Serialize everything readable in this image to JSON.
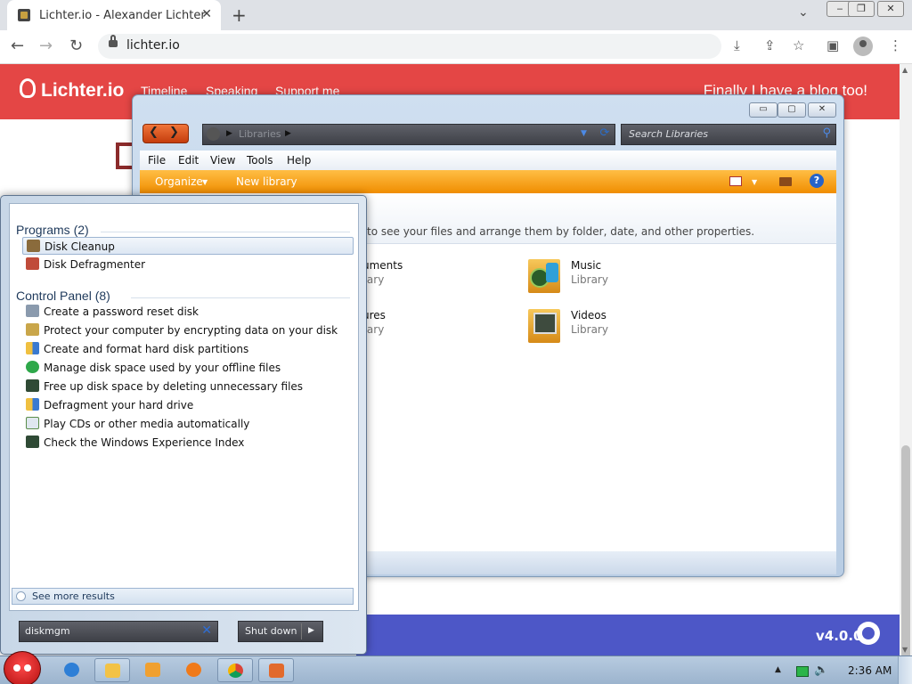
{
  "browser": {
    "tab_title": "Lichter.io - Alexander Lichter",
    "new_tab_glyph": "+",
    "url": "lichter.io"
  },
  "site": {
    "logo": "Lichter.io",
    "nav": [
      "Timeline",
      "Speaking",
      "Support me"
    ],
    "tagline": "Finally I have a blog too!",
    "version": "v4.0.0"
  },
  "explorer": {
    "breadcrumb": "Libraries",
    "search_placeholder": "Search Libraries",
    "menu": [
      "File",
      "Edit",
      "View",
      "Tools",
      "Help"
    ],
    "commands": {
      "organize": "Organize",
      "new_library": "New library"
    },
    "info_text": "to see your files and arrange them by folder, date, and other properties.",
    "libraries": [
      {
        "name": "uments",
        "type": "rary"
      },
      {
        "name": "Music",
        "type": "Library"
      },
      {
        "name": "ures",
        "type": "rary"
      },
      {
        "name": "Videos",
        "type": "Library"
      }
    ]
  },
  "start_menu": {
    "programs_heading": "Programs (2)",
    "programs": [
      "Disk Cleanup",
      "Disk Defragmenter"
    ],
    "control_panel_heading": "Control Panel (8)",
    "control_panel": [
      "Create a password reset disk",
      "Protect your computer by encrypting data on your disk",
      "Create and format hard disk partitions",
      "Manage disk space used by your offline files",
      "Free up disk space by deleting unnecessary files",
      "Defragment your hard drive",
      "Play CDs or other media automatically",
      "Check the Windows Experience Index"
    ],
    "see_more": "See more results",
    "search_value": "diskmgm",
    "shutdown": "Shut down"
  },
  "taskbar": {
    "clock": "2:36 AM",
    "buttons": [
      "internet-explorer-icon",
      "windows-explorer-icon",
      "media-player-icon",
      "firefox-icon",
      "chrome-icon",
      "paint-icon"
    ]
  },
  "colors": {
    "site_header": "#e44645",
    "footer": "#4d57c7",
    "command_bar": "#f08d00"
  }
}
